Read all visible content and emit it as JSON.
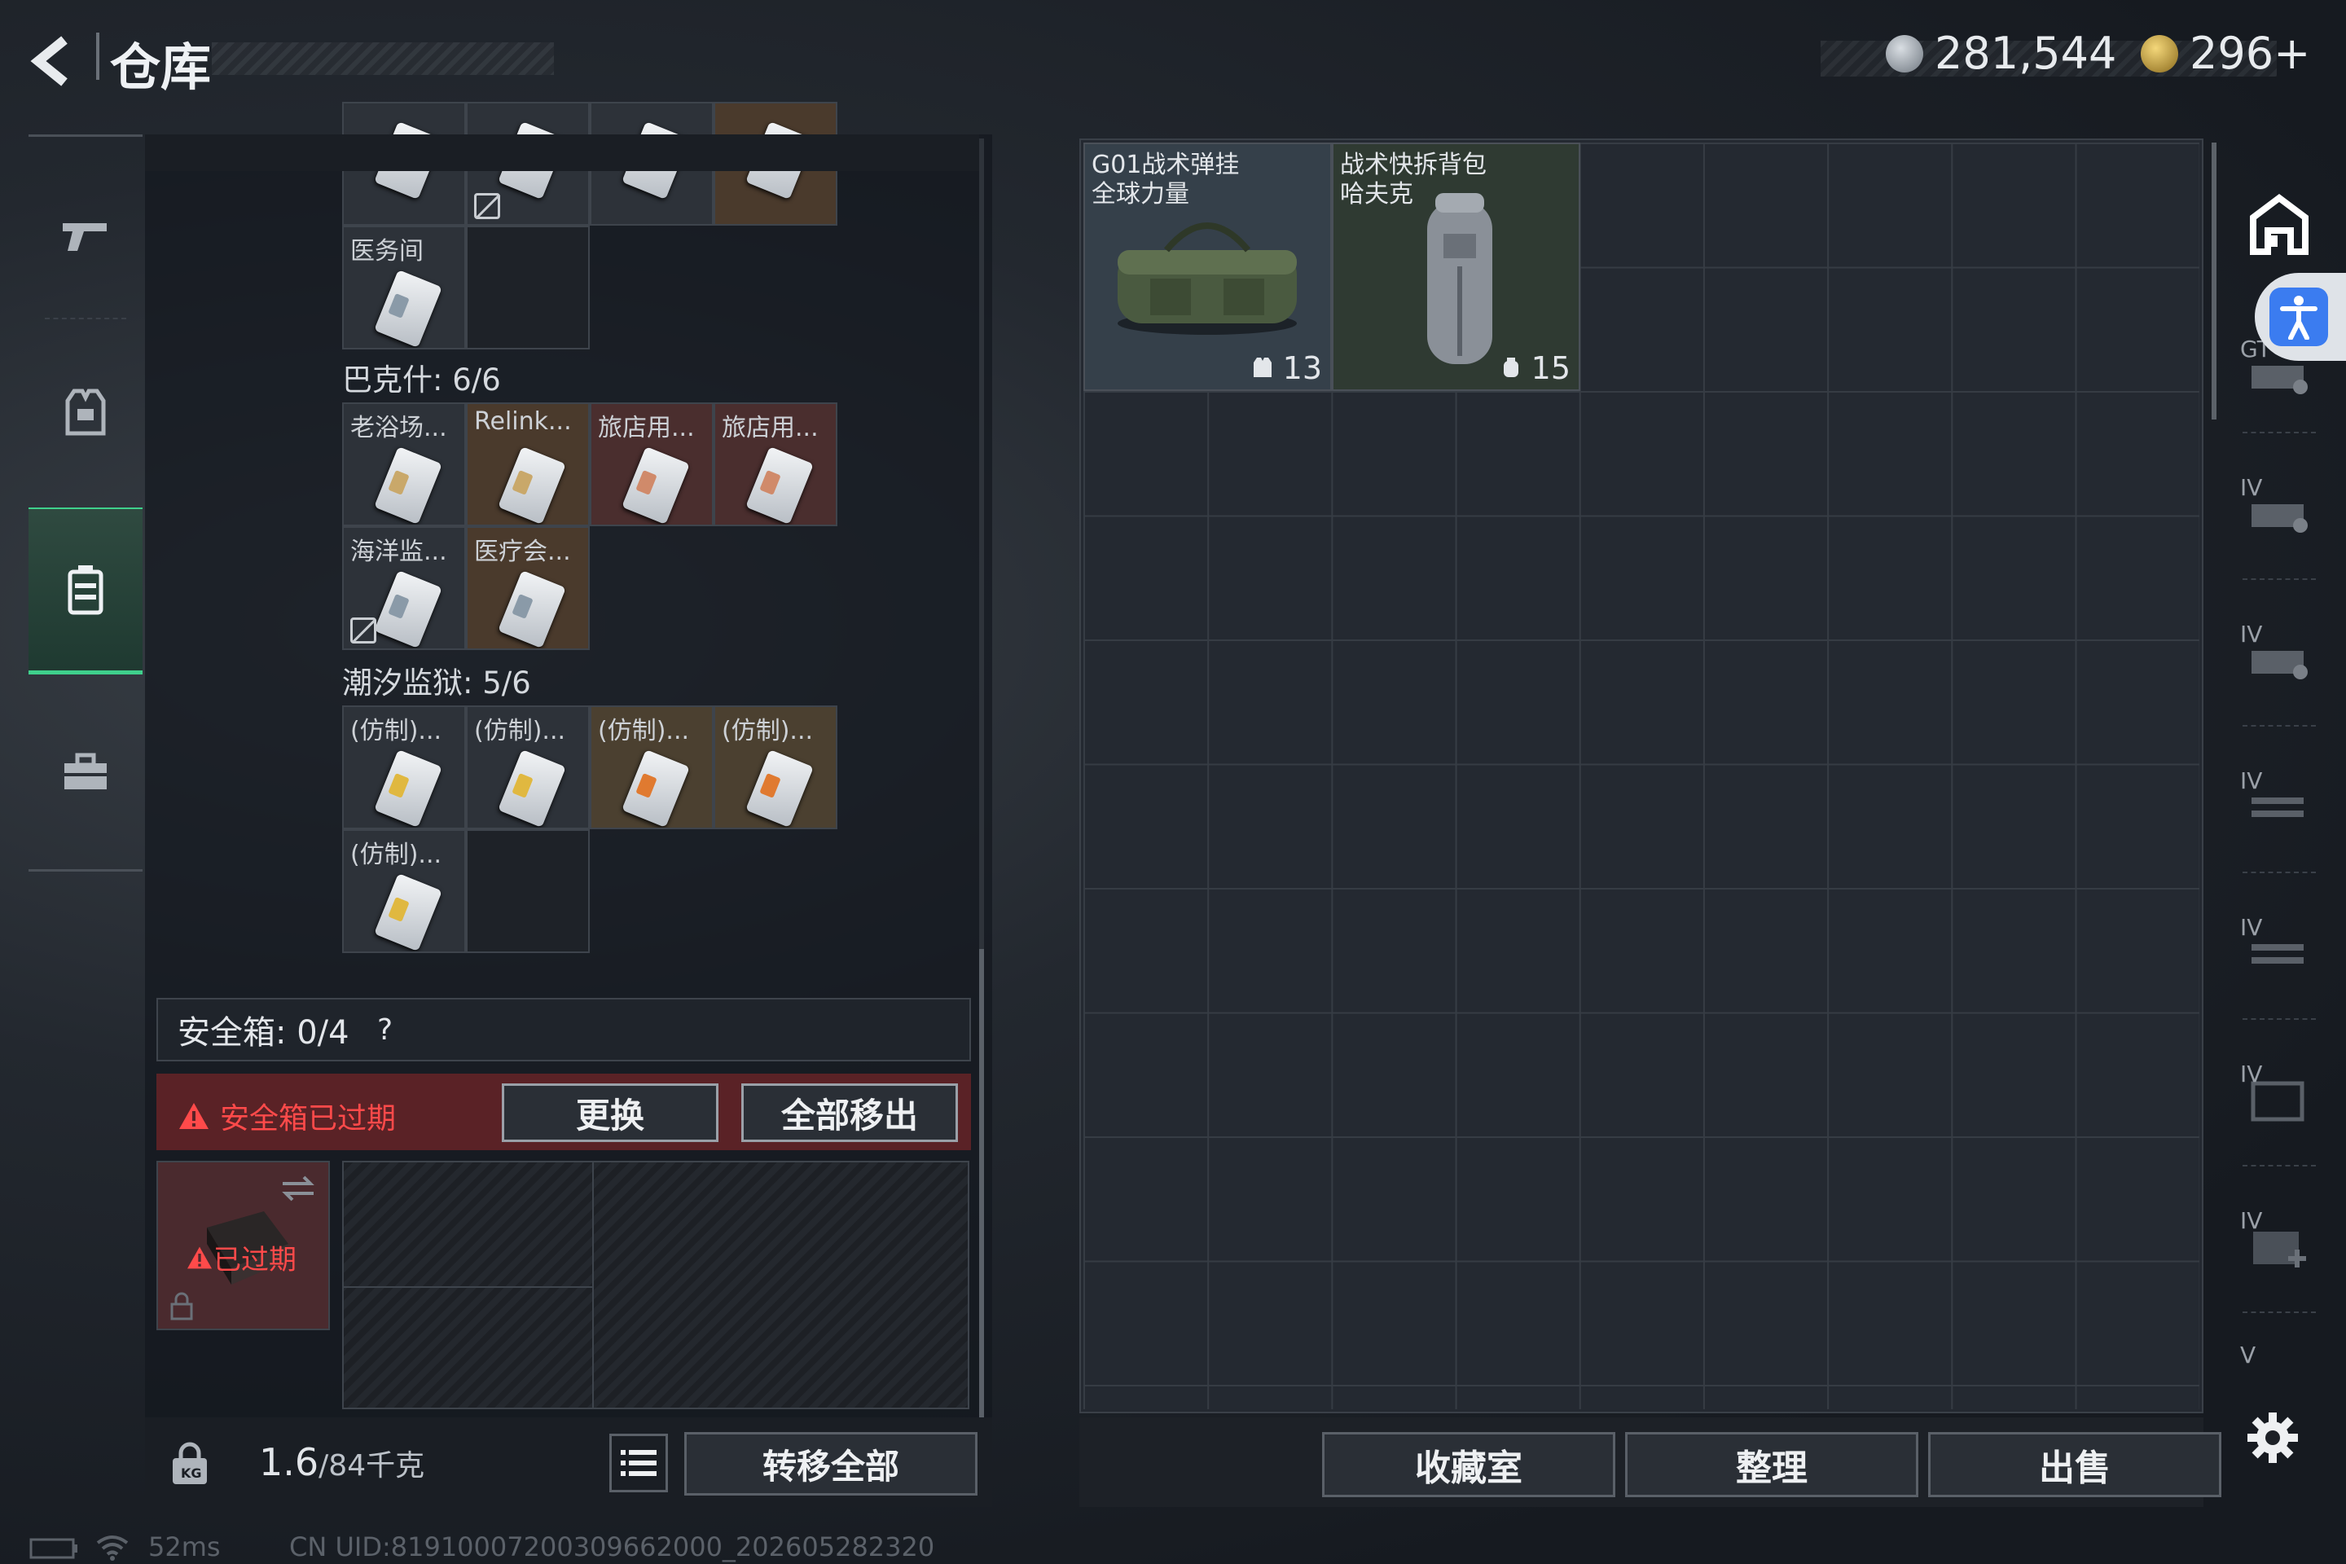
{
  "header": {
    "title": "仓库",
    "back_icon": "back-arrow-icon",
    "currency_silver": "281,544",
    "currency_gold": "296+",
    "silver_color": "#9aa3ad",
    "gold_color": "#c9a23c"
  },
  "left_nav": {
    "items": [
      {
        "name": "weapon-tab",
        "icon": "gun-icon",
        "active": false
      },
      {
        "name": "equipment-tab",
        "icon": "vest-icon",
        "active": false
      },
      {
        "name": "container-tab",
        "icon": "keycard-case-icon",
        "active": true
      },
      {
        "name": "toolbox-tab",
        "icon": "briefcase-icon",
        "active": false
      }
    ],
    "accent": "#3fd08c"
  },
  "key_groups": [
    {
      "label": "",
      "rows": [
        [
          {
            "name": "",
            "tone": "default"
          },
          {
            "name": "",
            "tone": "default",
            "no_check": true
          },
          {
            "name": "",
            "tone": "default"
          },
          {
            "name": "",
            "tone": "brown"
          }
        ],
        [
          {
            "name": "医务间",
            "tone": "default"
          },
          {
            "name": "",
            "tone": "empty"
          }
        ]
      ]
    },
    {
      "label": "巴克什: 6/6",
      "rows": [
        [
          {
            "name": "老浴场...",
            "tone": "default"
          },
          {
            "name": "Relink...",
            "tone": "brown"
          },
          {
            "name": "旅店用...",
            "tone": "red"
          },
          {
            "name": "旅店用...",
            "tone": "red"
          }
        ],
        [
          {
            "name": "海洋监...",
            "tone": "default",
            "no_check": true
          },
          {
            "name": "医疗会...",
            "tone": "brown"
          }
        ]
      ]
    },
    {
      "label": "潮汐监狱: 5/6",
      "rows": [
        [
          {
            "name": "(仿制)...",
            "tone": "default"
          },
          {
            "name": "(仿制)...",
            "tone": "default"
          },
          {
            "name": "(仿制)...",
            "tone": "gold"
          },
          {
            "name": "(仿制)...",
            "tone": "gold"
          }
        ],
        [
          {
            "name": "(仿制)...",
            "tone": "default"
          },
          {
            "name": "",
            "tone": "empty"
          }
        ]
      ]
    }
  ],
  "safe_box": {
    "label": "安全箱: 0/4",
    "help": "?",
    "warning": "安全箱已过期",
    "replace_button": "更换",
    "move_all_out_button": "全部移出",
    "expired_badge": "已过期"
  },
  "carry": {
    "weight_value": "1.6",
    "weight_max": "/84千克",
    "transfer_all_button": "转移全部"
  },
  "storage_items": [
    {
      "name_line1": "G01战术弹挂",
      "name_line2": "全球力量",
      "count": "13",
      "count_icon": "vest-small-icon"
    },
    {
      "name_line1": "战术快拆背包",
      "name_line2": "哈夫克",
      "count": "15",
      "count_icon": "backpack-small-icon"
    }
  ],
  "bottom_buttons": {
    "collection": "收藏室",
    "organize": "整理",
    "sell": "出售"
  },
  "right_side": {
    "tiers": [
      "GT",
      "IV",
      "IV",
      "IV",
      "IV",
      "IV",
      "IV",
      "V"
    ]
  },
  "status": {
    "ping": "52ms",
    "uid": "CN UID:8191000720030966​2000_202605282320"
  }
}
